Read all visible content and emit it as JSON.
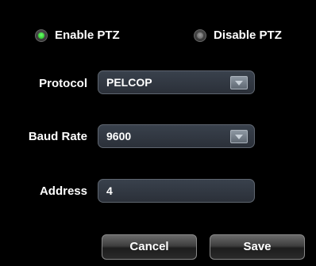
{
  "ptz": {
    "enable_label": "Enable PTZ",
    "disable_label": "Disable PTZ",
    "selected": "enable"
  },
  "protocol": {
    "label": "Protocol",
    "value": "PELCOP"
  },
  "baud_rate": {
    "label": "Baud Rate",
    "value": "9600"
  },
  "address": {
    "label": "Address",
    "value": "4"
  },
  "buttons": {
    "cancel": "Cancel",
    "save": "Save"
  },
  "colors": {
    "radio_on": "#19b319",
    "field_bg": "#2f353e",
    "background": "#000000"
  }
}
